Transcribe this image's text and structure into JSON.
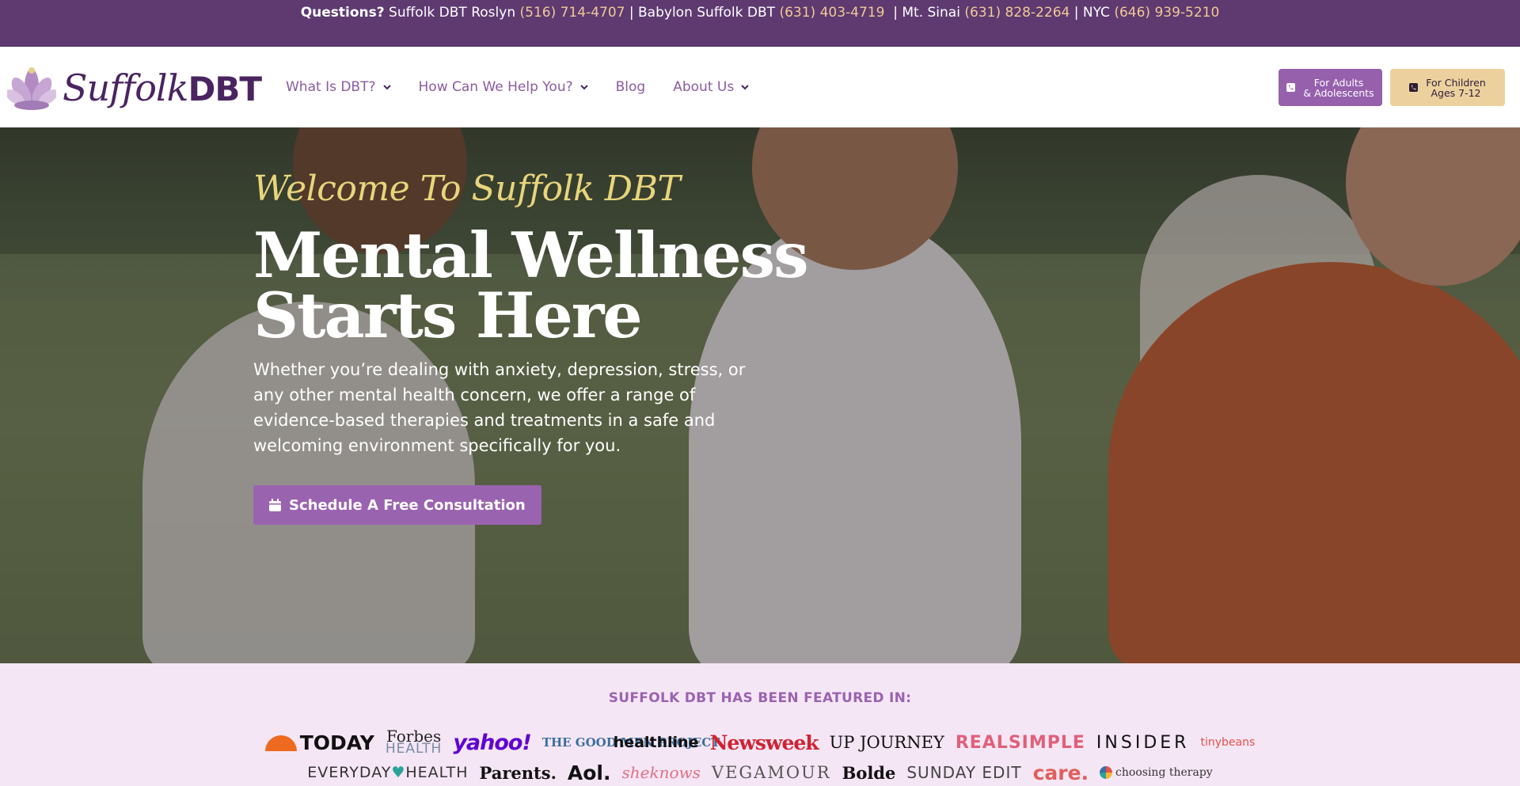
{
  "topbar": {
    "questions_label": "Questions?",
    "loc1": "Suffolk DBT Roslyn",
    "phone1": "(516) 714-4707",
    "sep1": "|",
    "loc2": "Babylon Suffolk DBT",
    "phone2": "(631) 403-4719",
    "sep2": "|",
    "loc3": "Mt. Sinai",
    "phone3": "(631) 828-2264",
    "sep3": "|",
    "loc4": "NYC",
    "phone4": "(646) 939-5210"
  },
  "logo": {
    "script": "Suffolk",
    "bold": "DBT",
    "icon": "lotus-icon"
  },
  "nav": [
    {
      "label": "What Is DBT?",
      "dropdown": true
    },
    {
      "label": "How Can We Help You?",
      "dropdown": true
    },
    {
      "label": "Blog",
      "dropdown": false
    },
    {
      "label": "About Us",
      "dropdown": true
    }
  ],
  "buttons": {
    "adults_line1": "For Adults",
    "adults_line2": "& Adolescents",
    "children_line1": "For Children",
    "children_line2": "Ages 7-12",
    "icon": "phone-icon"
  },
  "hero": {
    "welcome": "Welcome To Suffolk DBT",
    "headline_line1": "Mental Wellness",
    "headline_line2": "Starts Here",
    "lead": "Whether you’re dealing with anxiety, depression, stress, or any other mental health concern, we offer a range of evidence-based therapies and treatments in a safe and welcoming environment specifically for you.",
    "cta_label": "Schedule A Free Consultation",
    "cta_icon": "calendar-icon"
  },
  "featured": {
    "title": "SUFFOLK DBT HAS BEEN FEATURED IN:",
    "row1": [
      "TODAY",
      "Forbes",
      "HEALTH",
      "yahoo!",
      "THE GOOD MEN PROJECT",
      "healthline",
      "Newsweek",
      "UP JOURNEY",
      "REALSIMPLE",
      "INSIDER",
      "tinybeans"
    ],
    "row2": [
      "EVERYDAY",
      "HEALTH",
      "Parents.",
      "Aol.",
      "sheknows",
      "VEGAMOUR",
      "Bolde",
      "SUNDAY EDIT",
      "care.",
      "choosing therapy"
    ]
  },
  "colors": {
    "topbar_bg": "#5e3a71",
    "phone": "#f1c994",
    "brand_purple": "#9660ad",
    "nav_text": "#8b5ba1",
    "gold_button": "#ecd19f",
    "welcome_text": "#e8d57b",
    "featured_bg": "#f5e6f5"
  }
}
